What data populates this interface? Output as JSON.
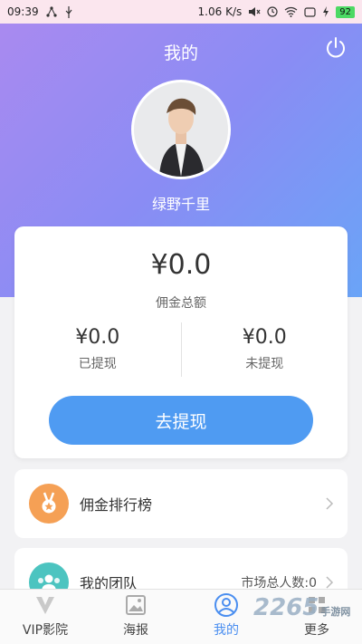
{
  "status_bar": {
    "time": "09:39",
    "speed": "1.06",
    "speed_unit": "K/s",
    "battery": "92"
  },
  "header": {
    "title": "我的",
    "username": "绿野千里"
  },
  "summary": {
    "total_amount": "¥0.0",
    "total_label": "佣金总额",
    "withdrawn_amount": "¥0.0",
    "withdrawn_label": "已提现",
    "pending_amount": "¥0.0",
    "pending_label": "未提现",
    "withdraw_button": "去提现"
  },
  "menu": {
    "ranking_label": "佣金排行榜",
    "team_label": "我的团队",
    "team_extra": "市场总人数:0"
  },
  "tabs": [
    {
      "label": "VIP影院",
      "icon": "v-logo-icon"
    },
    {
      "label": "海报",
      "icon": "image-icon"
    },
    {
      "label": "我的",
      "icon": "user-icon"
    },
    {
      "label": "更多",
      "icon": "grid-icon"
    }
  ],
  "watermark": {
    "brand": "2265",
    "sub": "手游网"
  },
  "colors": {
    "accent": "#4f9bf2",
    "hero_start": "#a98af0",
    "hero_end": "#6aa4f7",
    "medal": "#f5a055",
    "team": "#4cc4c0"
  }
}
